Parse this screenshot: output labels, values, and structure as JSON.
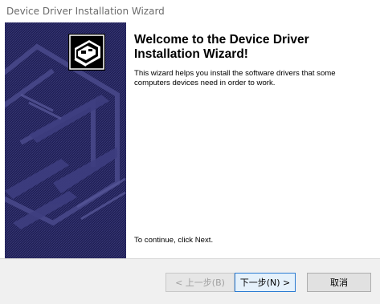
{
  "window": {
    "title": "Device Driver Installation Wizard"
  },
  "welcome": {
    "heading": "Welcome to the Device Driver Installation Wizard!",
    "description": "This wizard helps you install the software drivers that some computers devices need in order to work.",
    "continue_text": "To continue, click Next."
  },
  "side_panel": {
    "icon": "hardware-card-icon",
    "background_color": "#1c1c50"
  },
  "buttons": {
    "back_label": "< 上一步(B)",
    "next_label": "下一步(N) >",
    "cancel_label": "取消",
    "back_enabled": false
  },
  "colors": {
    "accent_border": "#2a7bd2"
  }
}
